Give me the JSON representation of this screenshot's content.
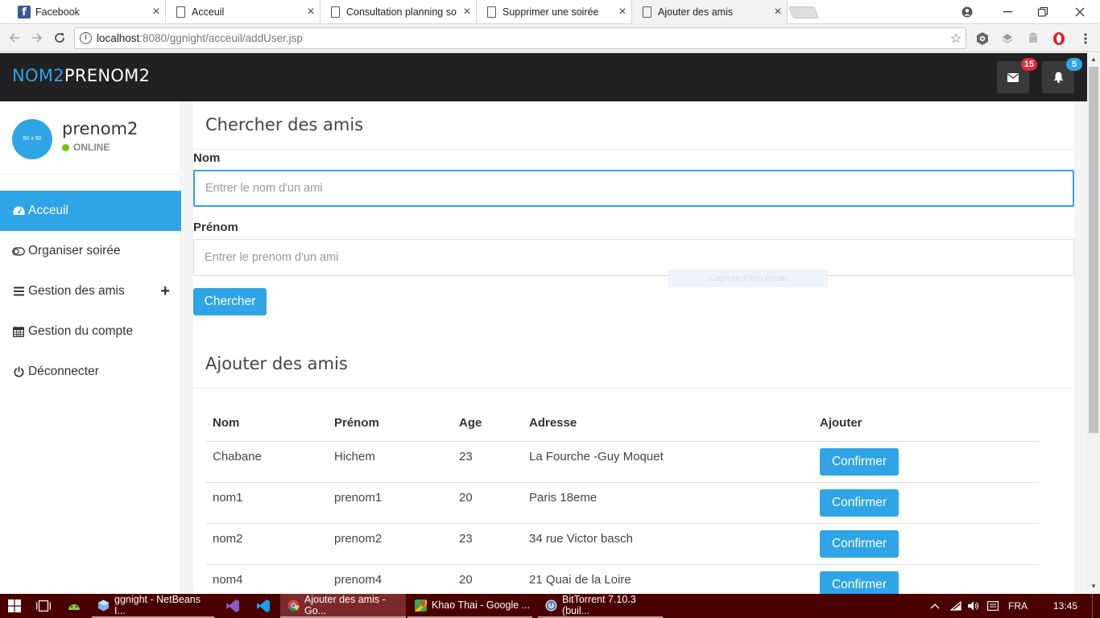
{
  "browser": {
    "tabs": [
      {
        "title": "Facebook",
        "icon": "facebook-icon",
        "active": false
      },
      {
        "title": "Acceuil",
        "icon": "document-icon",
        "active": false
      },
      {
        "title": "Consultation planning so",
        "icon": "document-icon",
        "active": false
      },
      {
        "title": "Supprimer une soirée",
        "icon": "document-icon",
        "active": false
      },
      {
        "title": "Ajouter des amis",
        "icon": "document-icon",
        "active": true
      }
    ],
    "url_host": "localhost",
    "url_rest": ":8080/ggnight/acceuil/addUser.jsp"
  },
  "header": {
    "brand_part1": "NOM2",
    "brand_part2": "PRENOM2",
    "messages_count": "15",
    "notifications_count": "5",
    "brand_color": "#2fa4e7"
  },
  "user": {
    "avatar_text": "50 x 50",
    "name": "prenom2",
    "status": "ONLINE",
    "status_color": "#73c700"
  },
  "sidebar": {
    "items": [
      {
        "label": "Acceuil",
        "icon": "dashboard-icon"
      },
      {
        "label": "Organiser soirée",
        "icon": "toggle-icon"
      },
      {
        "label": "Gestion des amis",
        "icon": "list-icon"
      },
      {
        "label": "Gestion du compte",
        "icon": "calendar-icon"
      },
      {
        "label": "Déconnecter",
        "icon": "power-icon"
      }
    ]
  },
  "search_panel": {
    "title": "Chercher des amis",
    "nom_label": "Nom",
    "nom_placeholder": "Entrer le nom d'un ami",
    "prenom_label": "Prénom",
    "prenom_placeholder": "Entrer le prenom d'un ami",
    "search_button": "Chercher",
    "overlay_text": "Capture Plein écran"
  },
  "add_panel": {
    "title": "Ajouter des amis",
    "columns": [
      "Nom",
      "Prénom",
      "Age",
      "Adresse",
      "Ajouter"
    ],
    "rows": [
      {
        "nom": "Chabane",
        "prenom": "Hichem",
        "age": "23",
        "adresse": "La Fourche -Guy Moquet",
        "action": "Confirmer"
      },
      {
        "nom": "nom1",
        "prenom": "prenom1",
        "age": "20",
        "adresse": "Paris 18eme",
        "action": "Confirmer"
      },
      {
        "nom": "nom2",
        "prenom": "prenom2",
        "age": "23",
        "adresse": "34 rue Victor basch",
        "action": "Confirmer"
      },
      {
        "nom": "nom4",
        "prenom": "prenom4",
        "age": "20",
        "adresse": "21 Quai de la Loire",
        "action": "Confirmer"
      }
    ]
  },
  "taskbar": {
    "items": [
      {
        "label": "ggnight - NetBeans I...",
        "icon": "netbeans-icon"
      },
      {
        "label": "Ajouter des amis - Go...",
        "icon": "chrome-icon"
      },
      {
        "label": "Khao Thai - Google ...",
        "icon": "maps-icon"
      },
      {
        "label": "BitTorrent 7.10.3  (buil...",
        "icon": "bittorrent-icon"
      }
    ],
    "language": "FRA",
    "time": "13:45"
  }
}
